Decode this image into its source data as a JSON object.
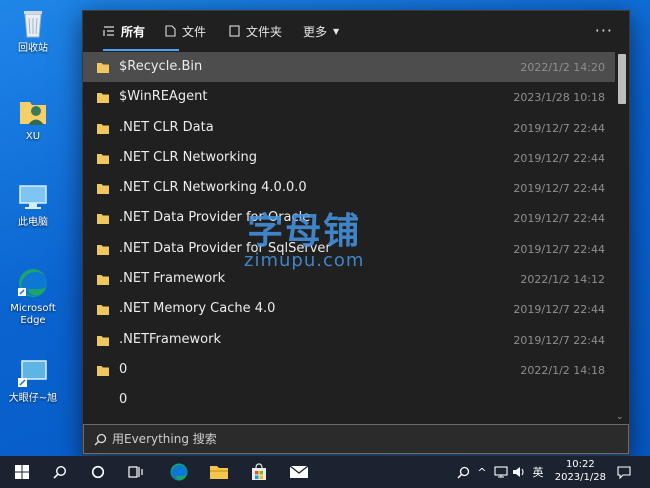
{
  "desktop": {
    "icons": [
      {
        "label": "回收站"
      },
      {
        "label": "XU"
      },
      {
        "label": "此电脑"
      },
      {
        "label": "Microsoft Edge"
      },
      {
        "label": "大眼仔~旭"
      }
    ]
  },
  "tabs": [
    {
      "label": "所有"
    },
    {
      "label": "文件"
    },
    {
      "label": "文件夹"
    },
    {
      "label": "更多"
    }
  ],
  "more_menu": "···",
  "results": [
    {
      "name": "$Recycle.Bin",
      "date": "2022/1/2 14:20"
    },
    {
      "name": "$WinREAgent",
      "date": "2023/1/28 10:18"
    },
    {
      "name": ".NET CLR Data",
      "date": "2019/12/7 22:44"
    },
    {
      "name": ".NET CLR Networking",
      "date": "2019/12/7 22:44"
    },
    {
      "name": ".NET CLR Networking 4.0.0.0",
      "date": "2019/12/7 22:44"
    },
    {
      "name": ".NET Data Provider for Oracle",
      "date": "2019/12/7 22:44"
    },
    {
      "name": ".NET Data Provider for SqlServer",
      "date": "2019/12/7 22:44"
    },
    {
      "name": ".NET Framework",
      "date": "2022/1/2 14:12"
    },
    {
      "name": ".NET Memory Cache 4.0",
      "date": "2019/12/7 22:44"
    },
    {
      "name": ".NETFramework",
      "date": "2019/12/7 22:44"
    },
    {
      "name": "0",
      "date": "2022/1/2 14:18"
    },
    {
      "name": "0",
      "date": ""
    }
  ],
  "search": {
    "placeholder": "用Everything 搜索"
  },
  "watermark": {
    "cn": "字母铺",
    "en": "zimupu.com"
  },
  "tray": {
    "ime": "英",
    "time": "10:22",
    "date": "2023/1/28"
  },
  "colors": {
    "accent": "#4aa3f5",
    "panel_bg": "#202020",
    "selected_row": "#4d4d4d",
    "folder": "#f0c75e"
  }
}
